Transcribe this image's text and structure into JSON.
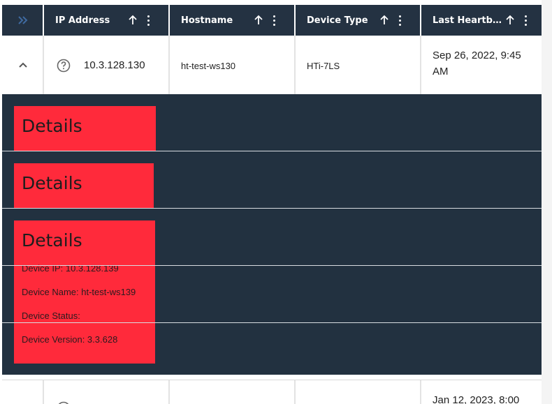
{
  "header": {
    "columns": [
      {
        "label": "IP Address"
      },
      {
        "label": "Hostname"
      },
      {
        "label": "Device Type"
      },
      {
        "label": "Last Heartbe..."
      }
    ]
  },
  "rows": [
    {
      "ip": "10.3.128.130",
      "hostname": "ht-test-ws130",
      "device_type": "HTi-7LS",
      "heartbeat_line1": "Sep 26, 2022, 9:45",
      "heartbeat_line2": "AM"
    },
    {
      "heartbeat_line1": "Jan 12, 2023, 8:00"
    }
  ],
  "details": [
    {
      "title": "Details"
    },
    {
      "title": "Details"
    },
    {
      "title": "Details",
      "device_ip": "Device IP: 10.3.128.139",
      "device_name": "Device Name: ht-test-ws139",
      "device_status": "Device Status:",
      "device_version": "Device Version: 3.3.628"
    }
  ],
  "colors": {
    "header_bg": "#243242",
    "detail_bg": "#223140",
    "card_bg": "#ff2a3b"
  }
}
